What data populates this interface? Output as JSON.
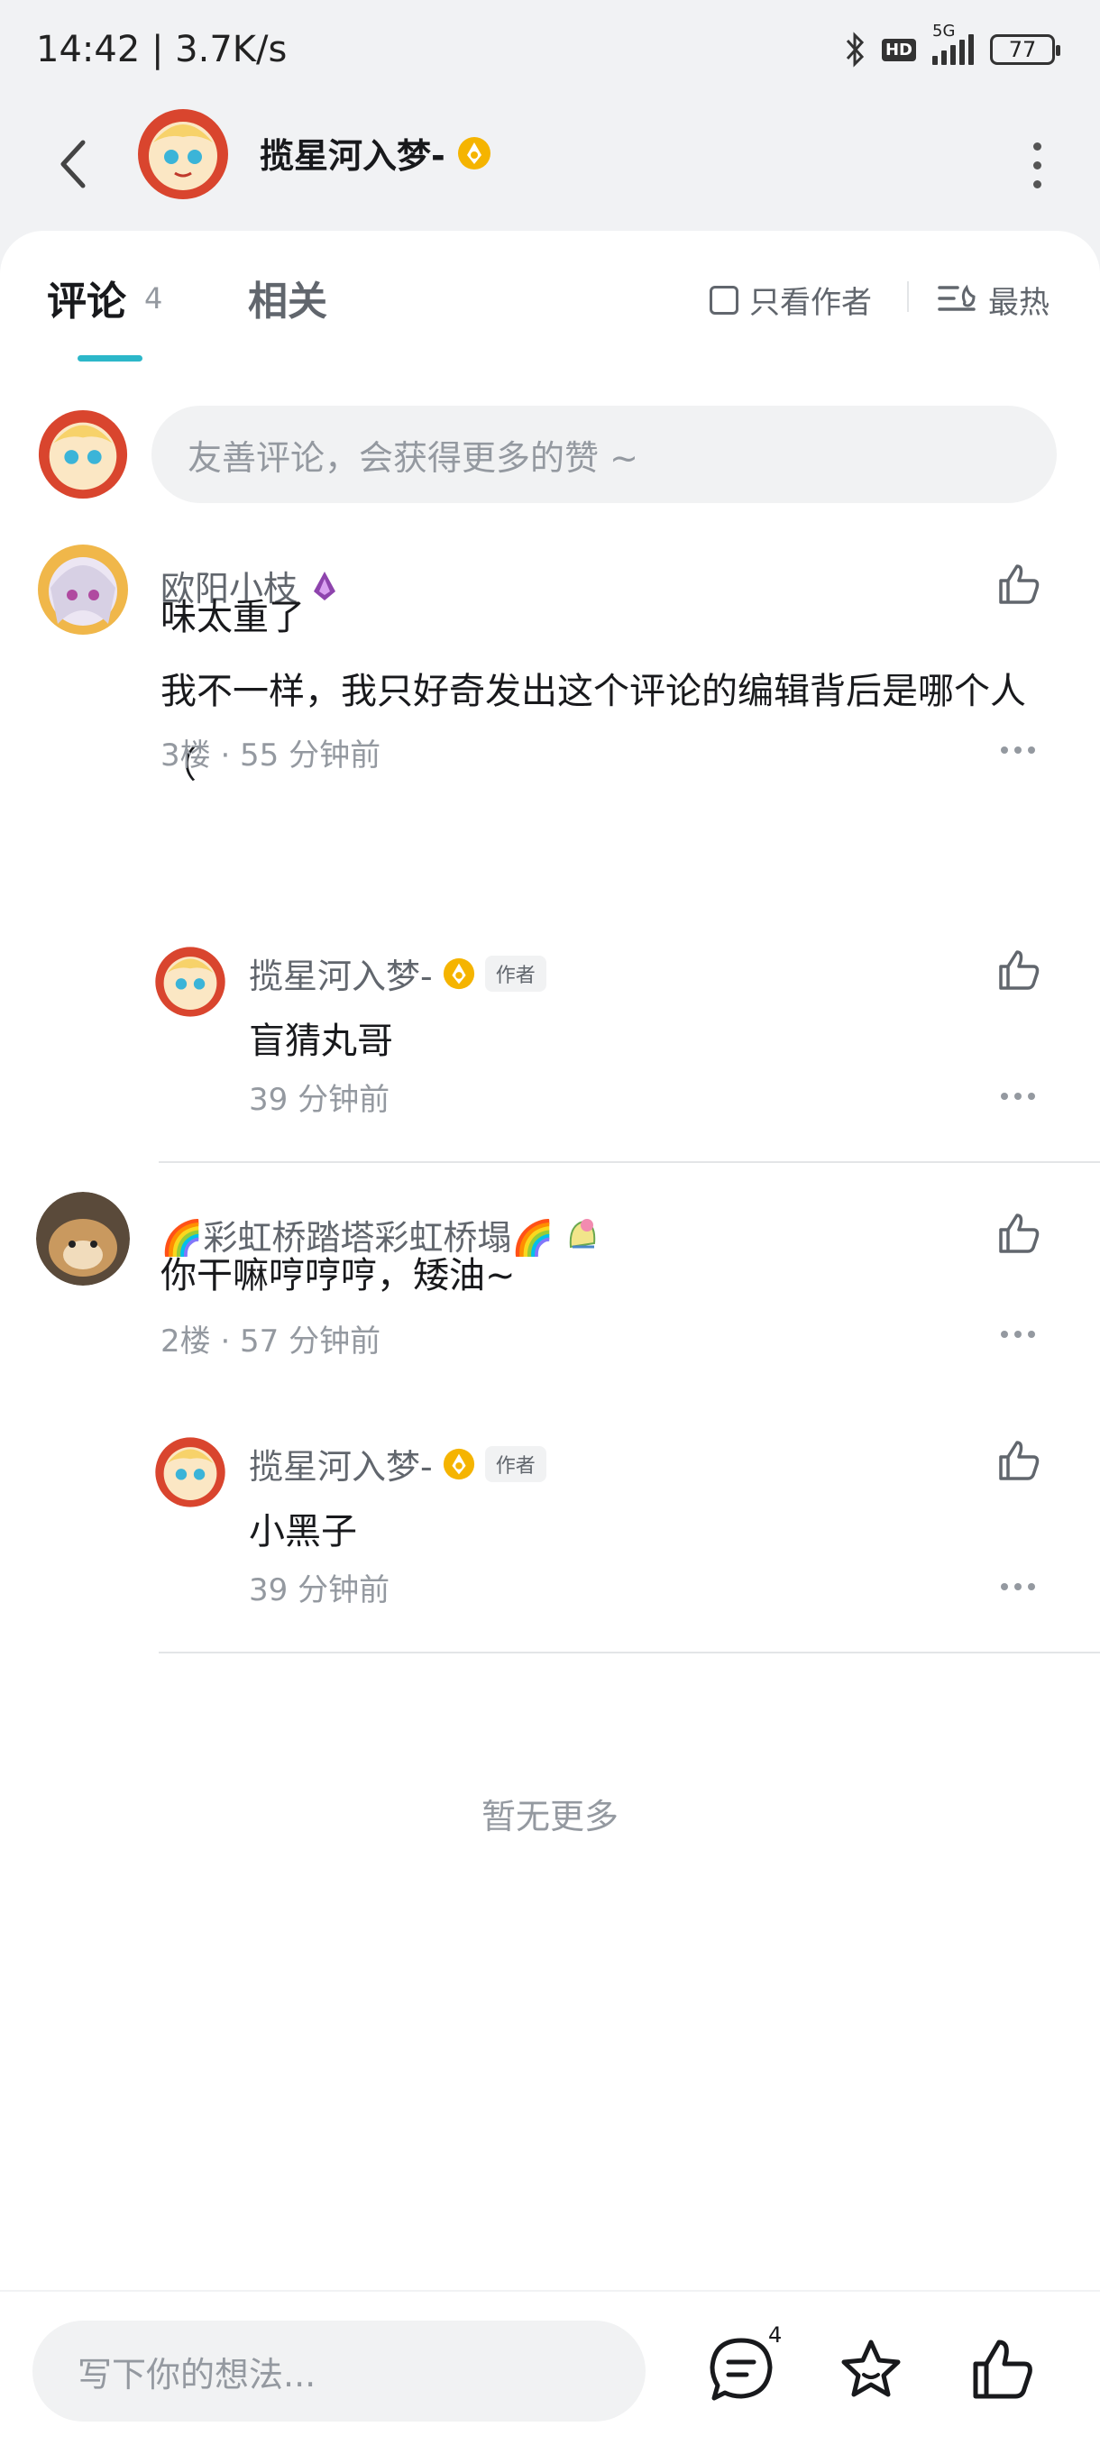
{
  "status": {
    "time": "14:42 | 3.7K/s",
    "network": "5G",
    "hd": "HD",
    "battery": "77"
  },
  "header": {
    "user_name": "揽星河入梦-"
  },
  "tabs": {
    "comment_label": "评论",
    "comment_count": "4",
    "related_label": "相关",
    "only_author": "只看作者",
    "sort": "最热"
  },
  "composer": {
    "placeholder": "友善评论，会获得更多的赞 ~"
  },
  "comments": [
    {
      "user": "欧阳小枝",
      "text_line1": "味太重了",
      "text_line2": "我不一样，我只好奇发出这个评论的编辑背后是哪个人（",
      "meta": "3楼 · 55 分钟前",
      "reply": {
        "user": "揽星河入梦-",
        "badge": "作者",
        "text": "盲猜丸哥",
        "meta": "39 分钟前"
      }
    },
    {
      "user": "🌈彩虹桥踏塔彩虹桥塌🌈",
      "text_line1": "你干嘛哼哼哼，矮油~",
      "meta": "2楼 · 57 分钟前",
      "reply": {
        "user": "揽星河入梦-",
        "badge": "作者",
        "text": "小黑子",
        "meta": "39 分钟前"
      }
    }
  ],
  "no_more": "暂无更多",
  "bottom": {
    "placeholder": "写下你的想法...",
    "comment_count": "4"
  },
  "colors": {
    "accent": "#2cb7c9",
    "gold": "#f5b400",
    "text_secondary": "#61666d",
    "text_muted": "#9499a0"
  },
  "icons": [
    "back-icon",
    "more-vertical-icon",
    "sort-icon",
    "like-icon",
    "more-dots-icon",
    "comment-bubble-icon",
    "favorite-star-icon",
    "level-icon"
  ]
}
